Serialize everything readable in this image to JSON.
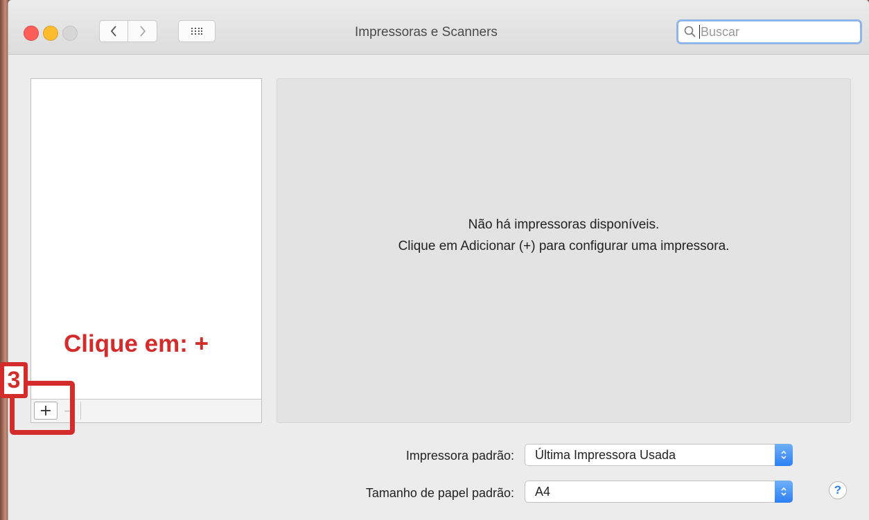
{
  "window": {
    "title": "Impressoras e Scanners",
    "search_placeholder": "Buscar"
  },
  "detail": {
    "message_line1": "Não há impressoras disponíveis.",
    "message_line2": "Clique em Adicionar (+) para configurar uma impressora."
  },
  "list_toolbar": {
    "add_label": "+",
    "remove_label": "−"
  },
  "settings": {
    "default_printer_label": "Impressora padrão:",
    "default_printer_value": "Última Impressora Usada",
    "paper_size_label": "Tamanho de papel padrão:",
    "paper_size_value": "A4"
  },
  "help_label": "?",
  "annotation": {
    "instruction": "Clique em: +",
    "step_number": "3",
    "color": "#d42b2b"
  },
  "icons": [
    "back-chevron-icon",
    "forward-chevron-icon",
    "grid-icon",
    "search-icon",
    "popup-arrows-icon"
  ],
  "colors": {
    "close": "#fc5f57",
    "minimize": "#fdbc2e",
    "popup_accent": "#2d7ff4",
    "search_focus": "#8fb4e8"
  }
}
